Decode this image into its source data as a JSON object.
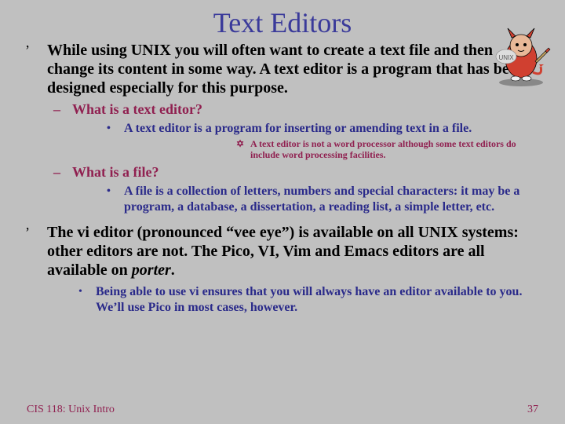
{
  "title": "Text Editors",
  "bullets": {
    "b1": "While using UNIX you will often want to create a text file and then change its content in some way.  A text editor is a program that has been designed especially for this purpose.",
    "b1_1": "What is a text editor?",
    "b1_1_1": "A text editor is a program for inserting or amending text in a file.",
    "b1_1_1_1": "A text editor is not a word processor although some text editors do include word processing facilities.",
    "b1_2": "What is a file?",
    "b1_2_1": "A file is a collection of letters, numbers and special characters: it may be a program, a database, a dissertation, a reading list, a simple letter, etc.",
    "b2_pre": "The vi editor (pronounced “vee eye”) is available on all UNIX systems: other editors are not.  The Pico, VI, Vim and Emacs editors are all available on ",
    "b2_em": "porter",
    "b2_post": ".",
    "b2_1": "Being able to use vi ensures that you will always have an editor available to you.  We’ll use Pico in most cases, however."
  },
  "footer": {
    "left": "CIS 118: Unix Intro",
    "right": "37"
  },
  "marks": {
    "l1": "’",
    "l2": "–",
    "l3": "•",
    "l4": "✡"
  }
}
